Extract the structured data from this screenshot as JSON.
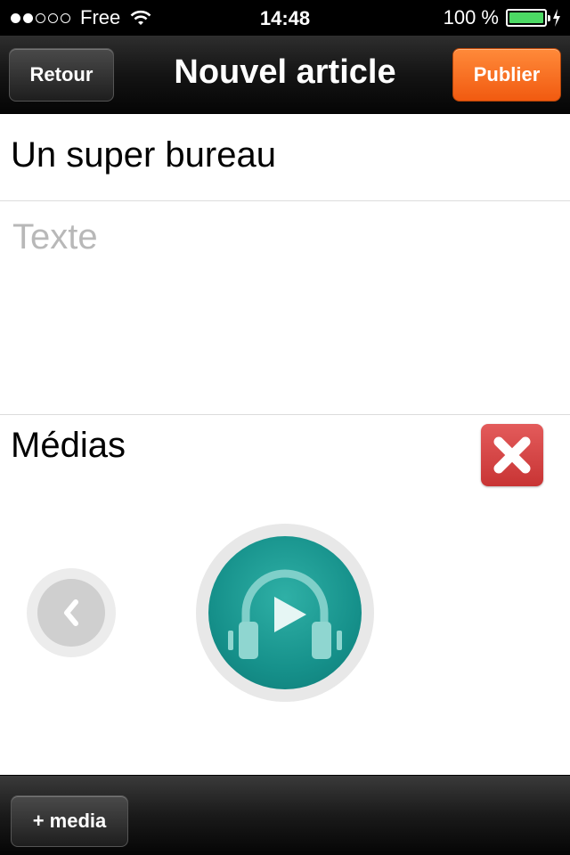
{
  "status_bar": {
    "carrier": "Free",
    "time": "14:48",
    "battery_percent": "100 %",
    "signal_bars_filled": 2,
    "signal_bars_total": 5
  },
  "nav": {
    "title": "Nouvel article",
    "back_label": "Retour",
    "publish_label": "Publier"
  },
  "form": {
    "title_value": "Un super bureau",
    "text_placeholder": "Texte"
  },
  "media": {
    "section_label": "Médias"
  },
  "toolbar": {
    "add_media_label": "+ media"
  },
  "colors": {
    "publish_accent": "#f15a10",
    "delete_red": "#d04040",
    "media_teal": "#16918b"
  }
}
